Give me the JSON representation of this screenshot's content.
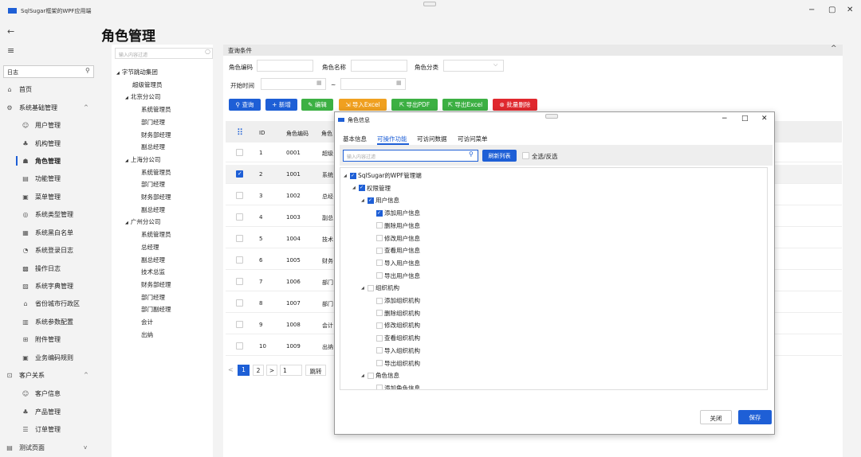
{
  "app": {
    "title": "SqlSugar框架的WPF应用端",
    "min": "−",
    "max": "▢",
    "close": "✕"
  },
  "sidebar": {
    "back": "←",
    "menu": "≡",
    "search_value": "日志",
    "items": [
      {
        "label": "首页",
        "icon": "⌂"
      },
      {
        "label": "系统基础管理",
        "icon": "⚙",
        "chev": "^"
      },
      {
        "label": "用户管理",
        "icon": "☺"
      },
      {
        "label": "机构管理",
        "icon": "♣"
      },
      {
        "label": "角色管理",
        "icon": "☗"
      },
      {
        "label": "功能管理",
        "icon": "▤"
      },
      {
        "label": "菜单管理",
        "icon": "▣"
      },
      {
        "label": "系统类型管理",
        "icon": "◎"
      },
      {
        "label": "系统黑白名单",
        "icon": "▦"
      },
      {
        "label": "系统登录日志",
        "icon": "◔"
      },
      {
        "label": "操作日志",
        "icon": "▩"
      },
      {
        "label": "系统字典管理",
        "icon": "▨"
      },
      {
        "label": "省份城市行政区",
        "icon": "⌂"
      },
      {
        "label": "系统参数配置",
        "icon": "▥"
      },
      {
        "label": "附件管理",
        "icon": "⊞"
      },
      {
        "label": "业务编码规则",
        "icon": "▣"
      },
      {
        "label": "客户关系",
        "icon": "⊡",
        "chev": "^"
      },
      {
        "label": "客户信息",
        "icon": "☺"
      },
      {
        "label": "产品管理",
        "icon": "♣"
      },
      {
        "label": "订单管理",
        "icon": "☰"
      },
      {
        "label": "测试页面",
        "icon": "▤",
        "chev": "v"
      }
    ]
  },
  "page": {
    "title": "角色管理"
  },
  "tree": {
    "placeholder": "输入内容过滤",
    "nodes": [
      {
        "label": "字节跳动集团",
        "arrow": "◢"
      },
      {
        "label": "超级管理员"
      },
      {
        "label": "北京分公司",
        "arrow": "◢"
      },
      {
        "label": "系统管理员"
      },
      {
        "label": "部门经理"
      },
      {
        "label": "财务部经理"
      },
      {
        "label": "副总经理"
      },
      {
        "label": "上海分公司",
        "arrow": "◢"
      },
      {
        "label": "系统管理员"
      },
      {
        "label": "部门经理"
      },
      {
        "label": "财务部经理"
      },
      {
        "label": "副总经理"
      },
      {
        "label": "广州分公司",
        "arrow": "◢"
      },
      {
        "label": "系统管理员"
      },
      {
        "label": "总经理"
      },
      {
        "label": "副总经理"
      },
      {
        "label": "技术总监"
      },
      {
        "label": "财务部经理"
      },
      {
        "label": "部门经理"
      },
      {
        "label": "部门副经理"
      },
      {
        "label": "会计"
      },
      {
        "label": "出纳"
      }
    ]
  },
  "query": {
    "header": "查询条件",
    "code_label": "角色编码",
    "name_label": "角色名称",
    "type_label": "角色分类",
    "start_label": "开始时间",
    "tilde": "~"
  },
  "toolbar": {
    "search": "查询",
    "add": "新增",
    "edit": "编辑",
    "import": "导入Excel",
    "pdf": "导出PDF",
    "excel": "导出Excel",
    "batch_delete": "批量删除",
    "colors": {
      "search": "#1e5fd6",
      "add": "#1e5fd6",
      "edit": "#3cb043",
      "import": "#f0a020",
      "pdf": "#3cb043",
      "excel": "#3cb043",
      "delete": "#e0282e"
    }
  },
  "grid": {
    "headers": {
      "id": "ID",
      "code": "角色编码",
      "name": "角色"
    },
    "rows": [
      {
        "id": "1",
        "code": "0001",
        "name": "超级"
      },
      {
        "id": "2",
        "code": "1001",
        "name": "系统"
      },
      {
        "id": "3",
        "code": "1002",
        "name": "总经"
      },
      {
        "id": "4",
        "code": "1003",
        "name": "副总"
      },
      {
        "id": "5",
        "code": "1004",
        "name": "技术"
      },
      {
        "id": "6",
        "code": "1005",
        "name": "财务"
      },
      {
        "id": "7",
        "code": "1006",
        "name": "部门"
      },
      {
        "id": "8",
        "code": "1007",
        "name": "部门"
      },
      {
        "id": "9",
        "code": "1008",
        "name": "会计"
      },
      {
        "id": "10",
        "code": "1009",
        "name": "出纳"
      }
    ]
  },
  "pager": {
    "prev": "<",
    "p1": "1",
    "p2": "2",
    "next": ">",
    "jump_value": "1",
    "jump": "跳转"
  },
  "dialog": {
    "title": "角色信息",
    "min": "−",
    "max": "□",
    "close": "✕",
    "tabs": [
      "基本信息",
      "可操作功能",
      "可访问数据",
      "可访问菜单"
    ],
    "filter_placeholder": "输入内容过滤",
    "refresh": "刷新列表",
    "select_all": "全选/反选",
    "perms": [
      {
        "label": "SqlSugar的WPF管理端",
        "arrow": "◢",
        "checked": true
      },
      {
        "label": "权限管理",
        "arrow": "◢",
        "checked": true
      },
      {
        "label": "用户信息",
        "arrow": "◢",
        "checked": true
      },
      {
        "label": "添加用户信息",
        "checked": true
      },
      {
        "label": "删除用户信息"
      },
      {
        "label": "修改用户信息"
      },
      {
        "label": "查看用户信息"
      },
      {
        "label": "导入用户信息"
      },
      {
        "label": "导出用户信息"
      },
      {
        "label": "组织机构",
        "arrow": "◢"
      },
      {
        "label": "添加组织机构"
      },
      {
        "label": "删除组织机构"
      },
      {
        "label": "修改组织机构"
      },
      {
        "label": "查看组织机构"
      },
      {
        "label": "导入组织机构"
      },
      {
        "label": "导出组织机构"
      },
      {
        "label": "角色信息",
        "arrow": "◢"
      },
      {
        "label": "添加角色信息"
      }
    ],
    "close_btn": "关闭",
    "save_btn": "保存"
  }
}
